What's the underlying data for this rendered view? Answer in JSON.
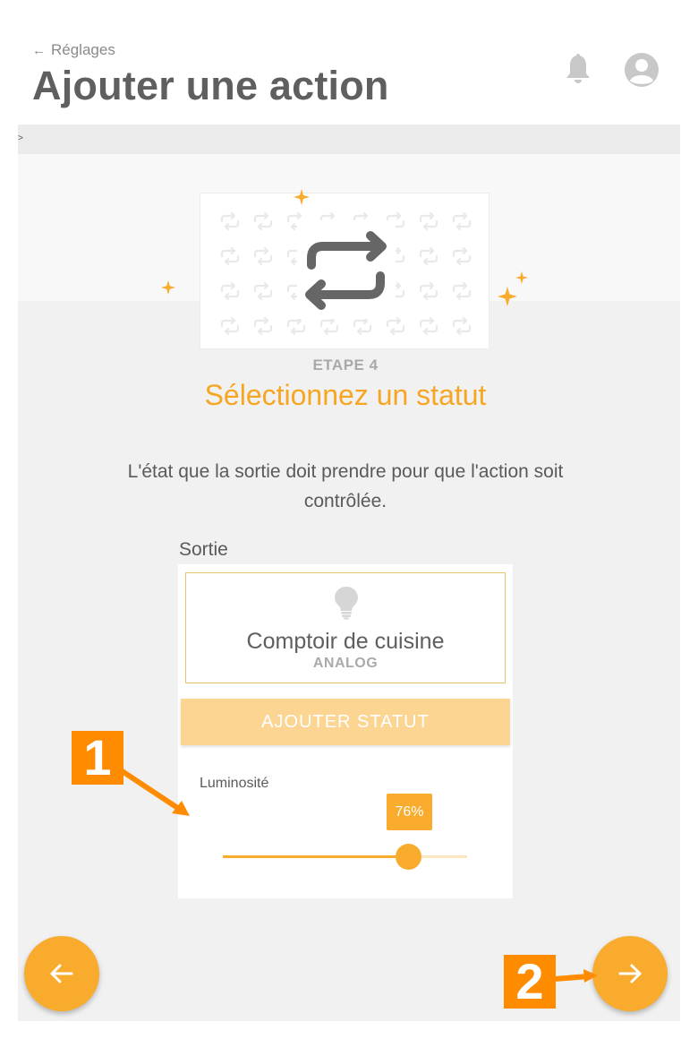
{
  "header": {
    "back_label": "Réglages",
    "title": "Ajouter une action",
    "icons": [
      "arrow-left-icon",
      "bell-icon",
      "user-avatar-icon"
    ]
  },
  "strip": {
    "marker": ">"
  },
  "step": {
    "label": "ETAPE 4",
    "title": "Sélectionnez un statut",
    "description": "L'état que la sortie doit prendre pour que l'action soit contrôlée."
  },
  "output": {
    "section_label": "Sortie",
    "name": "Comptoir de cuisine",
    "type": "ANALOG",
    "icon": "lightbulb-icon"
  },
  "add_status_label": "AJOUTER STATUT",
  "brightness": {
    "label": "Luminosité",
    "value_text": "76%",
    "value": 0.76
  },
  "annotations": {
    "marker1": "1",
    "marker2": "2"
  },
  "colors": {
    "accent": "#f8ab2c",
    "accent_light": "#fdd593",
    "title_orange": "#f6a623",
    "annotation": "#ff8c00",
    "background": "#f1f1f1"
  }
}
